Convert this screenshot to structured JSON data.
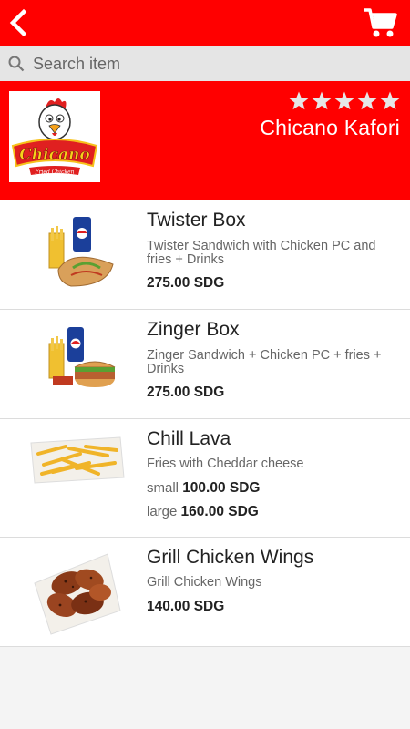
{
  "header": {
    "back_icon": "chevron-left-icon",
    "cart_icon": "shopping-cart-icon",
    "color": "#ff0000"
  },
  "search": {
    "placeholder": "Search item"
  },
  "store": {
    "name": "Chicano Kafori",
    "rating_stars": 5,
    "logo": {
      "brand": "Chicano",
      "tagline": "Fried Chicken"
    }
  },
  "items": [
    {
      "name": "Twister Box",
      "description": "Twister Sandwich with Chicken PC and fries + Drinks",
      "price": "275.00 SDG"
    },
    {
      "name": "Zinger Box",
      "description": "Zinger Sandwich + Chicken PC + fries + Drinks",
      "price": "275.00 SDG"
    },
    {
      "name": "Chill Lava",
      "description": "Fries with Cheddar cheese",
      "sizes": [
        {
          "label": "small",
          "price": "100.00 SDG"
        },
        {
          "label": "large",
          "price": "160.00 SDG"
        }
      ]
    },
    {
      "name": "Grill Chicken Wings",
      "description": "Grill Chicken Wings",
      "price": "140.00 SDG"
    }
  ]
}
